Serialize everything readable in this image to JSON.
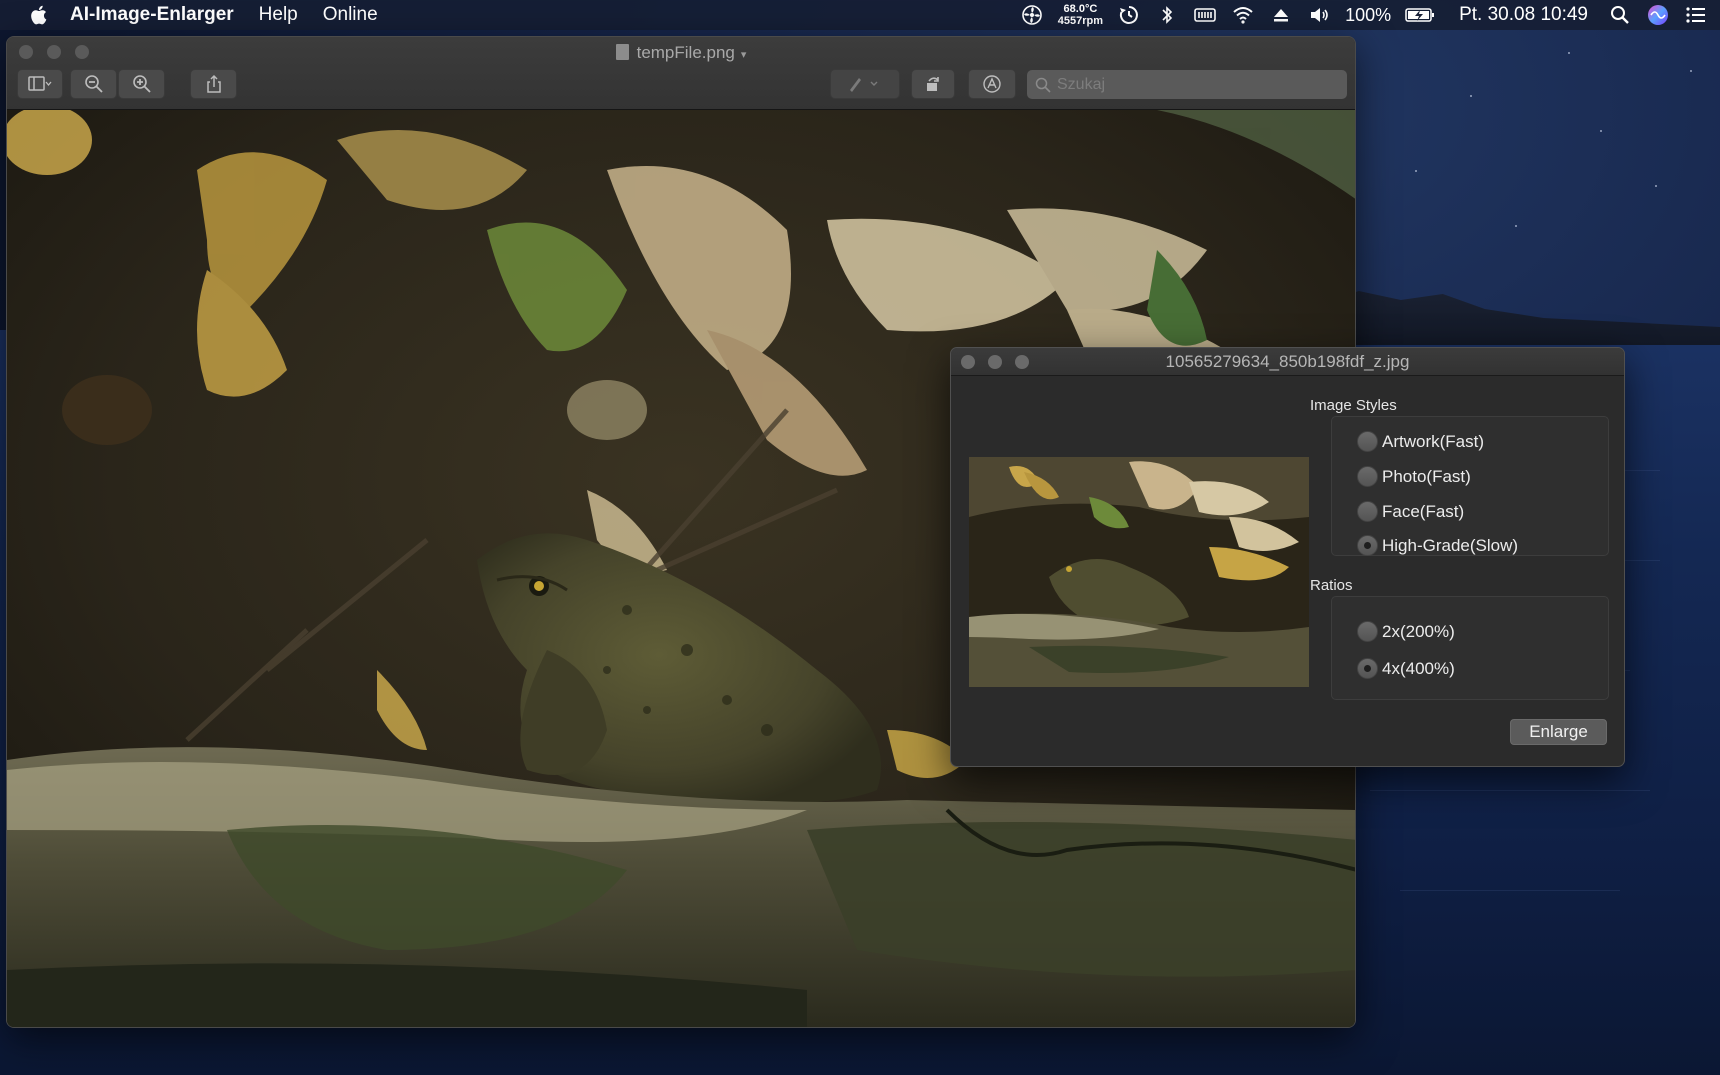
{
  "menubar": {
    "app_name": "AI-Image-Enlarger",
    "menus": [
      "Help",
      "Online"
    ],
    "temperature": "68.0°C",
    "fan_speed": "4557rpm",
    "battery_percent": "100%",
    "datetime": "Pt. 30.08  10:49"
  },
  "preview": {
    "title": "tempFile.png",
    "search_placeholder": "Szukaj"
  },
  "enlarger": {
    "title": "10565279634_850b198fdf_z.jpg",
    "image_styles": {
      "label": "Image Styles",
      "options": [
        "Artwork(Fast)",
        "Photo(Fast)",
        "Face(Fast)",
        "High-Grade(Slow)"
      ],
      "selected": "High-Grade(Slow)"
    },
    "ratios": {
      "label": "Ratios",
      "options": [
        "2x(200%)",
        "4x(400%)"
      ],
      "selected": "4x(400%)"
    },
    "enlarge_label": "Enlarge"
  },
  "colors": {
    "window_bg": "#2b2b2b",
    "desktop": "#16254a"
  }
}
